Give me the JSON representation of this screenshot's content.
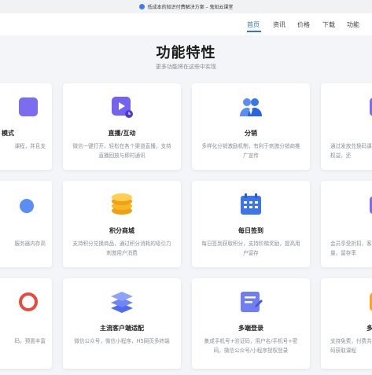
{
  "browser": {
    "tab_title": "低成本的知识付费解决方案 – 鬼知云课堂"
  },
  "nav": {
    "items": [
      {
        "label": "首页"
      },
      {
        "label": "资讯"
      },
      {
        "label": "价格"
      },
      {
        "label": "下载"
      },
      {
        "label": "功能"
      }
    ],
    "active_index": 0
  },
  "hero": {
    "title": "功能特性",
    "subtitle": "更多功能将在这些中实现"
  },
  "cards": [
    {
      "title": "模式",
      "desc": "课程，并且支",
      "icon": "play-square-icon"
    },
    {
      "title": "直播/互动",
      "desc": "微信一键打开，轻松在各个渠道直播，支持直播回放与即时通讯",
      "icon": "live-play-icon"
    },
    {
      "title": "分销",
      "desc": "多样化分销激励机制，有利于刺激分销商推广宣传",
      "icon": "users-icon"
    },
    {
      "title": "",
      "desc": "通过发放兑换码课程和权益，还",
      "icon": "ticket-icon"
    },
    {
      "title": "",
      "desc": "服务器内存高",
      "icon": "cloud-icon"
    },
    {
      "title": "积分商城",
      "desc": "支持积分兑换商品，通过积分消耗的吸引力刺激用户消费",
      "icon": "coins-icon"
    },
    {
      "title": "每日签到",
      "desc": "每日签到获取积分，支持阶梯奖励，提高用户留存",
      "icon": "calendar-icon"
    },
    {
      "title": "",
      "desc": "会员享受折扣，客户量，留存率",
      "icon": "member-icon"
    },
    {
      "title": "",
      "desc": "码，预置丰富",
      "icon": "target-icon"
    },
    {
      "title": "主流客户端适配",
      "desc": "微信公众号，微信小程序，H5网页多终端",
      "icon": "layers-icon"
    },
    {
      "title": "多端登录",
      "desc": "集成手机号+验证码，用户名/手机号+密码，微信公众号/小程序授权登录",
      "icon": "login-card-icon"
    },
    {
      "title": "多样",
      "desc": "支持免费，付费共提供码获取课程",
      "icon": "multi-icon"
    }
  ]
}
